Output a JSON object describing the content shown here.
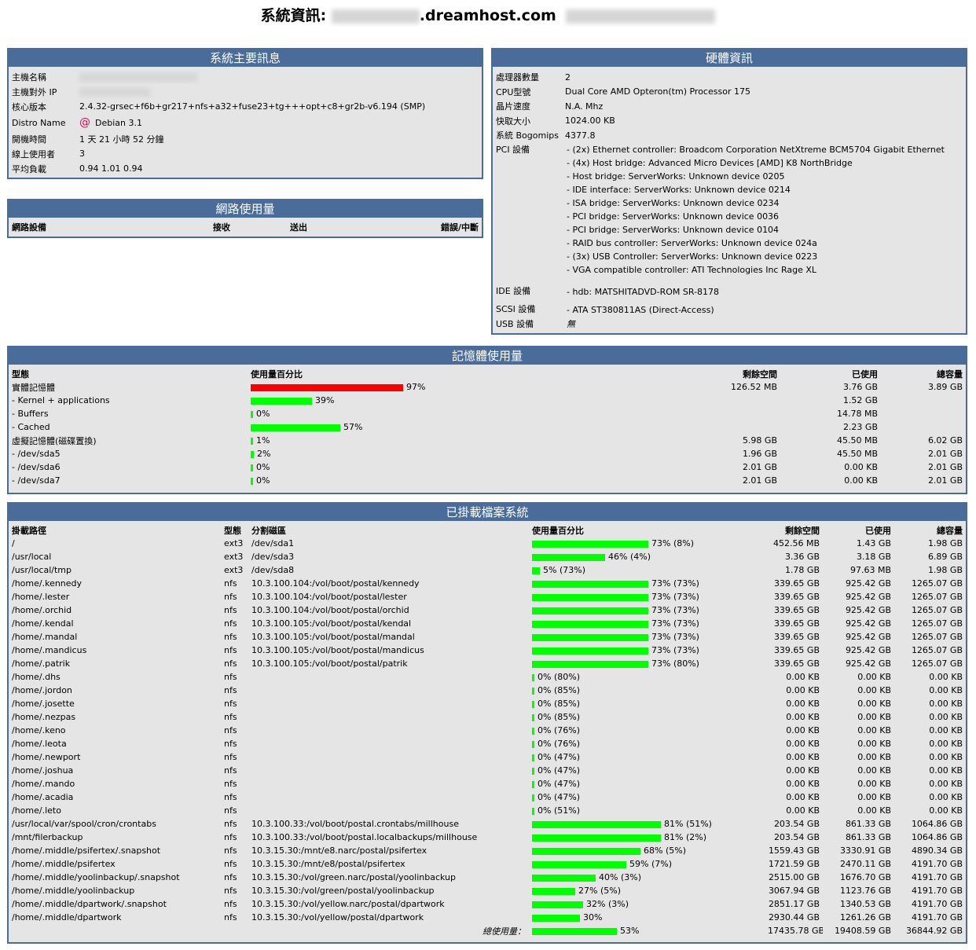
{
  "header": {
    "title_prefix": "系統資訊:",
    "host": ".dreamhost.com"
  },
  "sysinfo": {
    "title": "系統主要訊息",
    "rows": [
      {
        "label": "主機名稱",
        "value": "",
        "blurred": true
      },
      {
        "label": "主機對外 IP",
        "value": "",
        "blurred": true
      },
      {
        "label": "核心版本",
        "value": "2.4.32-grsec+f6b+gr217+nfs+a32+fuse23+tg+++opt+c8+gr2b-v6.194 (SMP)"
      },
      {
        "label": "Distro Name",
        "value": "Debian 3.1",
        "icon": "debian-logo-icon"
      },
      {
        "label": "開機時間",
        "value": "1 天 21 小時 52 分鐘"
      },
      {
        "label": "線上使用者",
        "value": "3"
      },
      {
        "label": "平均負載",
        "value": "0.94 1.01 0.94"
      }
    ]
  },
  "network": {
    "title": "網路使用量",
    "headers": [
      "網路設備",
      "接收",
      "送出",
      "錯誤/中斷"
    ]
  },
  "hardware": {
    "title": "硬體資訊",
    "rows": [
      {
        "label": "處理器數量",
        "value": "2"
      },
      {
        "label": "CPU型號",
        "value": "Dual Core AMD Opteron(tm) Processor 175"
      },
      {
        "label": "晶片速度",
        "value": "N.A. Mhz"
      },
      {
        "label": "快取大小",
        "value": "1024.00 KB"
      },
      {
        "label": "系統 Bogomips",
        "value": "4377.8"
      }
    ],
    "pci_label": "PCI 設備",
    "pci": [
      "- (2x) Ethernet controller: Broadcom Corporation NetXtreme BCM5704 Gigabit Ethernet",
      "- (4x) Host bridge: Advanced Micro Devices [AMD] K8 NorthBridge",
      "- Host bridge: ServerWorks: Unknown device 0205",
      "- IDE interface: ServerWorks: Unknown device 0214",
      "- ISA bridge: ServerWorks: Unknown device 0234",
      "- PCI bridge: ServerWorks: Unknown device 0036",
      "- PCI bridge: ServerWorks: Unknown device 0104",
      "- RAID bus controller: ServerWorks: Unknown device 024a",
      "- (3x) USB Controller: ServerWorks: Unknown device 0223",
      "- VGA compatible controller: ATI Technologies Inc Rage XL"
    ],
    "ide_label": "IDE 設備",
    "ide": "- hdb: MATSHITADVD-ROM SR-8178",
    "scsi_label": "SCSI 設備",
    "scsi": "- ATA ST380811AS (Direct-Access)",
    "usb_label": "USB 設備",
    "usb": "無"
  },
  "memory": {
    "title": "記憶體使用量",
    "headers": [
      "型態",
      "使用量百分比",
      "剩餘空間",
      "已使用",
      "總容量"
    ],
    "rows": [
      {
        "type": "實體記憶體",
        "pct": 97,
        "pct_text": "97%",
        "free": "126.52 MB",
        "used": "3.76 GB",
        "total": "3.89 GB",
        "red": true
      },
      {
        "type": "- Kernel + applications",
        "pct": 39,
        "pct_text": "39%",
        "free": "",
        "used": "1.52 GB",
        "total": ""
      },
      {
        "type": "- Buffers",
        "pct": 0,
        "pct_text": "0%",
        "free": "",
        "used": "14.78 MB",
        "total": ""
      },
      {
        "type": "- Cached",
        "pct": 57,
        "pct_text": "57%",
        "free": "",
        "used": "2.23 GB",
        "total": ""
      },
      {
        "type": "虛擬記憶體(磁碟置換)",
        "pct": 1,
        "pct_text": "1%",
        "free": "5.98 GB",
        "used": "45.50 MB",
        "total": "6.02 GB"
      },
      {
        "type": "- /dev/sda5",
        "pct": 2,
        "pct_text": "2%",
        "free": "1.96 GB",
        "used": "45.50 MB",
        "total": "2.01 GB"
      },
      {
        "type": "- /dev/sda6",
        "pct": 0,
        "pct_text": "0%",
        "free": "2.01 GB",
        "used": "0.00 KB",
        "total": "2.01 GB"
      },
      {
        "type": "- /dev/sda7",
        "pct": 0,
        "pct_text": "0%",
        "free": "2.01 GB",
        "used": "0.00 KB",
        "total": "2.01 GB"
      }
    ]
  },
  "filesystems": {
    "title": "已掛載檔案系統",
    "headers": [
      "掛載路徑",
      "型態",
      "分割磁區",
      "使用量百分比",
      "剩餘空間",
      "已使用",
      "總容量"
    ],
    "rows": [
      {
        "mount": "/",
        "type": "ext3",
        "part": "/dev/sda1",
        "pct": 73,
        "pct_text": "73% (8%)",
        "free": "452.56 MB",
        "used": "1.43 GB",
        "total": "1.98 GB"
      },
      {
        "mount": "/usr/local",
        "type": "ext3",
        "part": "/dev/sda3",
        "pct": 46,
        "pct_text": "46% (4%)",
        "free": "3.36 GB",
        "used": "3.18 GB",
        "total": "6.89 GB"
      },
      {
        "mount": "/usr/local/tmp",
        "type": "ext3",
        "part": "/dev/sda8",
        "pct": 5,
        "pct_text": "5% (73%)",
        "free": "1.78 GB",
        "used": "97.63 MB",
        "total": "1.98 GB"
      },
      {
        "mount": "/home/.kennedy",
        "type": "nfs",
        "part": "10.3.100.104:/vol/boot/postal/kennedy",
        "pct": 73,
        "pct_text": "73% (73%)",
        "free": "339.65 GB",
        "used": "925.42 GB",
        "total": "1265.07 GB"
      },
      {
        "mount": "/home/.lester",
        "type": "nfs",
        "part": "10.3.100.104:/vol/boot/postal/lester",
        "pct": 73,
        "pct_text": "73% (73%)",
        "free": "339.65 GB",
        "used": "925.42 GB",
        "total": "1265.07 GB"
      },
      {
        "mount": "/home/.orchid",
        "type": "nfs",
        "part": "10.3.100.104:/vol/boot/postal/orchid",
        "pct": 73,
        "pct_text": "73% (73%)",
        "free": "339.65 GB",
        "used": "925.42 GB",
        "total": "1265.07 GB"
      },
      {
        "mount": "/home/.kendal",
        "type": "nfs",
        "part": "10.3.100.105:/vol/boot/postal/kendal",
        "pct": 73,
        "pct_text": "73% (73%)",
        "free": "339.65 GB",
        "used": "925.42 GB",
        "total": "1265.07 GB"
      },
      {
        "mount": "/home/.mandal",
        "type": "nfs",
        "part": "10.3.100.105:/vol/boot/postal/mandal",
        "pct": 73,
        "pct_text": "73% (73%)",
        "free": "339.65 GB",
        "used": "925.42 GB",
        "total": "1265.07 GB"
      },
      {
        "mount": "/home/.mandicus",
        "type": "nfs",
        "part": "10.3.100.105:/vol/boot/postal/mandicus",
        "pct": 73,
        "pct_text": "73% (73%)",
        "free": "339.65 GB",
        "used": "925.42 GB",
        "total": "1265.07 GB"
      },
      {
        "mount": "/home/.patrik",
        "type": "nfs",
        "part": "10.3.100.105:/vol/boot/postal/patrik",
        "pct": 73,
        "pct_text": "73% (80%)",
        "free": "339.65 GB",
        "used": "925.42 GB",
        "total": "1265.07 GB"
      },
      {
        "mount": "/home/.dhs",
        "type": "nfs",
        "part": "",
        "pct": 0,
        "pct_text": "0% (80%)",
        "free": "0.00 KB",
        "used": "0.00 KB",
        "total": "0.00 KB"
      },
      {
        "mount": "/home/.jordon",
        "type": "nfs",
        "part": "",
        "pct": 0,
        "pct_text": "0% (85%)",
        "free": "0.00 KB",
        "used": "0.00 KB",
        "total": "0.00 KB"
      },
      {
        "mount": "/home/.josette",
        "type": "nfs",
        "part": "",
        "pct": 0,
        "pct_text": "0% (85%)",
        "free": "0.00 KB",
        "used": "0.00 KB",
        "total": "0.00 KB"
      },
      {
        "mount": "/home/.nezpas",
        "type": "nfs",
        "part": "",
        "pct": 0,
        "pct_text": "0% (85%)",
        "free": "0.00 KB",
        "used": "0.00 KB",
        "total": "0.00 KB"
      },
      {
        "mount": "/home/.keno",
        "type": "nfs",
        "part": "",
        "pct": 0,
        "pct_text": "0% (76%)",
        "free": "0.00 KB",
        "used": "0.00 KB",
        "total": "0.00 KB"
      },
      {
        "mount": "/home/.leota",
        "type": "nfs",
        "part": "",
        "pct": 0,
        "pct_text": "0% (76%)",
        "free": "0.00 KB",
        "used": "0.00 KB",
        "total": "0.00 KB"
      },
      {
        "mount": "/home/.newport",
        "type": "nfs",
        "part": "",
        "pct": 0,
        "pct_text": "0% (47%)",
        "free": "0.00 KB",
        "used": "0.00 KB",
        "total": "0.00 KB"
      },
      {
        "mount": "/home/.joshua",
        "type": "nfs",
        "part": "",
        "pct": 0,
        "pct_text": "0% (47%)",
        "free": "0.00 KB",
        "used": "0.00 KB",
        "total": "0.00 KB"
      },
      {
        "mount": "/home/.mando",
        "type": "nfs",
        "part": "",
        "pct": 0,
        "pct_text": "0% (47%)",
        "free": "0.00 KB",
        "used": "0.00 KB",
        "total": "0.00 KB"
      },
      {
        "mount": "/home/.acadia",
        "type": "nfs",
        "part": "",
        "pct": 0,
        "pct_text": "0% (47%)",
        "free": "0.00 KB",
        "used": "0.00 KB",
        "total": "0.00 KB"
      },
      {
        "mount": "/home/.leto",
        "type": "nfs",
        "part": "",
        "pct": 0,
        "pct_text": "0% (51%)",
        "free": "0.00 KB",
        "used": "0.00 KB",
        "total": "0.00 KB"
      },
      {
        "mount": "/usr/local/var/spool/cron/crontabs",
        "type": "nfs",
        "part": "10.3.100.33:/vol/boot/postal.crontabs/millhouse",
        "pct": 81,
        "pct_text": "81% (51%)",
        "free": "203.54 GB",
        "used": "861.33 GB",
        "total": "1064.86 GB"
      },
      {
        "mount": "/mnt/filerbackup",
        "type": "nfs",
        "part": "10.3.100.33:/vol/boot/postal.localbackups/millhouse",
        "pct": 81,
        "pct_text": "81% (2%)",
        "free": "203.54 GB",
        "used": "861.33 GB",
        "total": "1064.86 GB"
      },
      {
        "mount": "/home/.middle/psifertex/.snapshot",
        "type": "nfs",
        "part": "10.3.15.30:/mnt/e8.narc/postal/psifertex",
        "pct": 68,
        "pct_text": "68% (5%)",
        "free": "1559.43 GB",
        "used": "3330.91 GB",
        "total": "4890.34 GB"
      },
      {
        "mount": "/home/.middle/psifertex",
        "type": "nfs",
        "part": "10.3.15.30:/mnt/e8/postal/psifertex",
        "pct": 59,
        "pct_text": "59% (7%)",
        "free": "1721.59 GB",
        "used": "2470.11 GB",
        "total": "4191.70 GB"
      },
      {
        "mount": "/home/.middle/yoolinbackup/.snapshot",
        "type": "nfs",
        "part": "10.3.15.30:/vol/green.narc/postal/yoolinbackup",
        "pct": 40,
        "pct_text": "40% (3%)",
        "free": "2515.00 GB",
        "used": "1676.70 GB",
        "total": "4191.70 GB"
      },
      {
        "mount": "/home/.middle/yoolinbackup",
        "type": "nfs",
        "part": "10.3.15.30:/vol/green/postal/yoolinbackup",
        "pct": 27,
        "pct_text": "27% (5%)",
        "free": "3067.94 GB",
        "used": "1123.76 GB",
        "total": "4191.70 GB"
      },
      {
        "mount": "/home/.middle/dpartwork/.snapshot",
        "type": "nfs",
        "part": "10.3.15.30:/vol/yellow.narc/postal/dpartwork",
        "pct": 32,
        "pct_text": "32% (3%)",
        "free": "2851.17 GB",
        "used": "1340.53 GB",
        "total": "4191.70 GB"
      },
      {
        "mount": "/home/.middle/dpartwork",
        "type": "nfs",
        "part": "10.3.15.30:/vol/yellow/postal/dpartwork",
        "pct": 30,
        "pct_text": "30%",
        "free": "2930.44 GB",
        "used": "1261.26 GB",
        "total": "4191.70 GB"
      }
    ],
    "total": {
      "label": "總使用量：",
      "pct": 53,
      "pct_text": "53%",
      "free": "17435.78 GB",
      "used": "19408.59 GB",
      "total": "36844.92 GB"
    }
  },
  "colors": {
    "header_bg": "#4a6c9b",
    "panel_bg": "#e5e5e5",
    "bar_green": "#00ff00",
    "bar_red": "#ff0000"
  }
}
